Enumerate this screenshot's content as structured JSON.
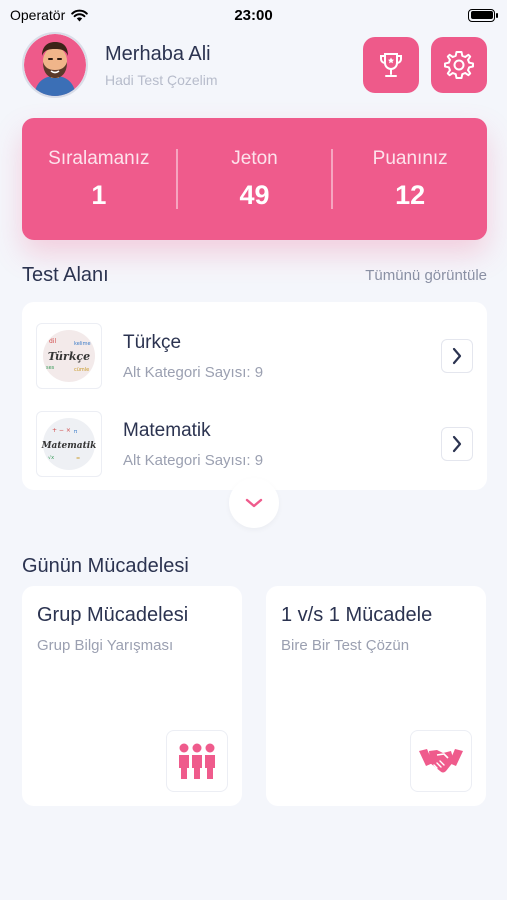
{
  "status_bar": {
    "carrier": "Operatör",
    "time": "23:00"
  },
  "header": {
    "greeting": "Merhaba Ali",
    "subtitle": "Hadi Test Çozelim"
  },
  "stats": [
    {
      "label": "Sıralamanız",
      "value": "1"
    },
    {
      "label": "Jeton",
      "value": "49"
    },
    {
      "label": "Puanınız",
      "value": "12"
    }
  ],
  "test_section": {
    "title": "Test Alanı",
    "see_all": "Tümünü görüntüle",
    "items": [
      {
        "name": "Türkçe",
        "sub": "Alt Kategori Sayısı: 9",
        "thumb_text": "Türkçe"
      },
      {
        "name": "Matematik",
        "sub": "Alt Kategori Sayısı: 9",
        "thumb_text": "Matematik"
      }
    ]
  },
  "challenge_section": {
    "title": "Günün Mücadelesi",
    "cards": [
      {
        "title": "Grup Mücadelesi",
        "sub": "Grup Bilgi Yarışması",
        "icon": "group-icon"
      },
      {
        "title": "1 v/s 1 Mücadele",
        "sub": "Bire Bir Test Çözün",
        "icon": "handshake-icon"
      }
    ]
  },
  "colors": {
    "accent": "#ef5b8c",
    "background": "#f4f6fb",
    "text": "#2b3350"
  }
}
